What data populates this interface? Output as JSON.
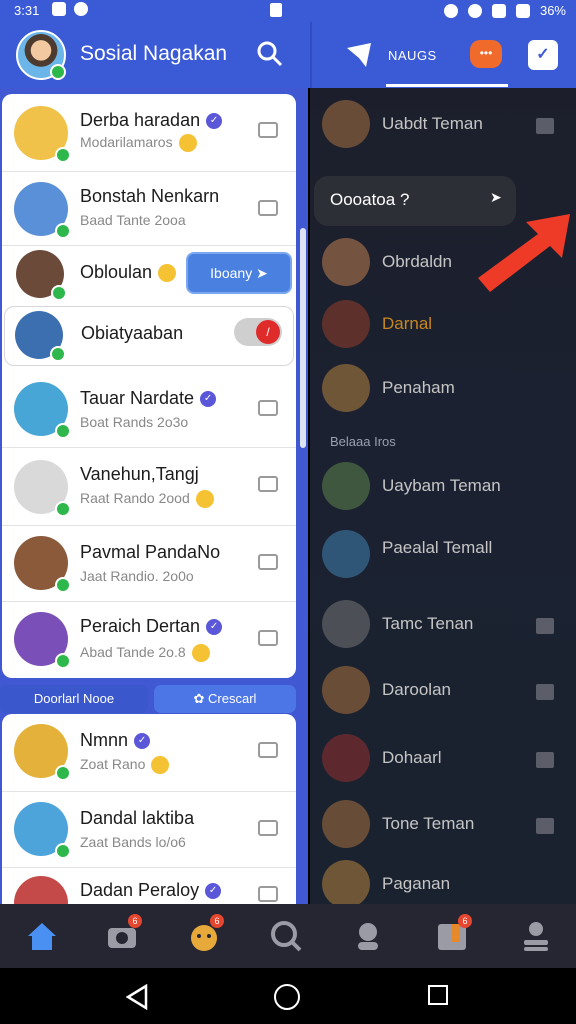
{
  "status_bar": {
    "time": "3:31",
    "battery": "36%"
  },
  "header": {
    "app_title": "Sosial Nagakan",
    "tab_label": "NAUGS",
    "chat_badge": "•••"
  },
  "left_list": {
    "card1": [
      {
        "name": "Derba haradan",
        "sub": "Modarilamaros",
        "avatar_color": "#f1c24a"
      },
      {
        "name": "Bonstah Nenkarn",
        "sub": "Baad Tante 2ooa",
        "avatar_color": "#5a90d8"
      }
    ],
    "row_obloulan": {
      "name": "Obloulan",
      "button": "Iboany"
    },
    "row_obiatyaban": {
      "name": "Obiatyaaban"
    },
    "card2": [
      {
        "name": "Tauar Nardate",
        "sub": "Boat Rands 2o3o",
        "avatar_color": "#47a6d6"
      },
      {
        "name": "Vanehun,Tangj",
        "sub": "Raat Rando 2ood",
        "avatar_color": "#d9d9d9"
      },
      {
        "name": "Pavmal PandaNo",
        "sub": "Jaat Randio. 2o0o",
        "avatar_color": "#8a5a3b"
      },
      {
        "name": "Peraich Dertan",
        "sub": "Abad Tande 2o.8",
        "avatar_color": "#7a4fb8"
      }
    ],
    "tabs": {
      "left": "Doorlarl Nooe",
      "right": "Crescarl"
    },
    "card3": [
      {
        "name": "Nmnn",
        "sub": "Zoat Rano",
        "avatar_color": "#e4b23a"
      },
      {
        "name": "Dandal laktiba",
        "sub": "Zaat Bands lo/o6",
        "avatar_color": "#4da4db"
      },
      {
        "name": "Dadan Peraloy",
        "sub": "",
        "avatar_color": "#c44a4a"
      }
    ]
  },
  "right_list": {
    "tooltip": "Oooatoa ?",
    "items_top": [
      {
        "name": "Uabdt Teman"
      },
      {
        "name": "Obrdaldn"
      },
      {
        "name": "Darnal"
      },
      {
        "name": "Penaham"
      }
    ],
    "section_label": "Belaaa Iros",
    "items_bottom": [
      {
        "name": "Uaybam Teman"
      },
      {
        "name": "Paealal Temall"
      },
      {
        "name": "Tamc Tenan"
      },
      {
        "name": "Daroolan"
      },
      {
        "name": "Dohaarl"
      },
      {
        "name": "Tone Teman"
      },
      {
        "name": "Paganan"
      }
    ]
  },
  "bottom_nav": {
    "items": [
      "home-icon",
      "camera-icon",
      "pet-icon",
      "search-icon",
      "people-icon",
      "inbox-icon",
      "profile-icon"
    ],
    "badges": [
      "",
      "6",
      "6",
      "",
      "",
      "6",
      ""
    ]
  },
  "colors": {
    "primary": "#3b5bd6",
    "accent": "#f06a2c",
    "online": "#2eb84b",
    "alert": "#e02b2b"
  }
}
